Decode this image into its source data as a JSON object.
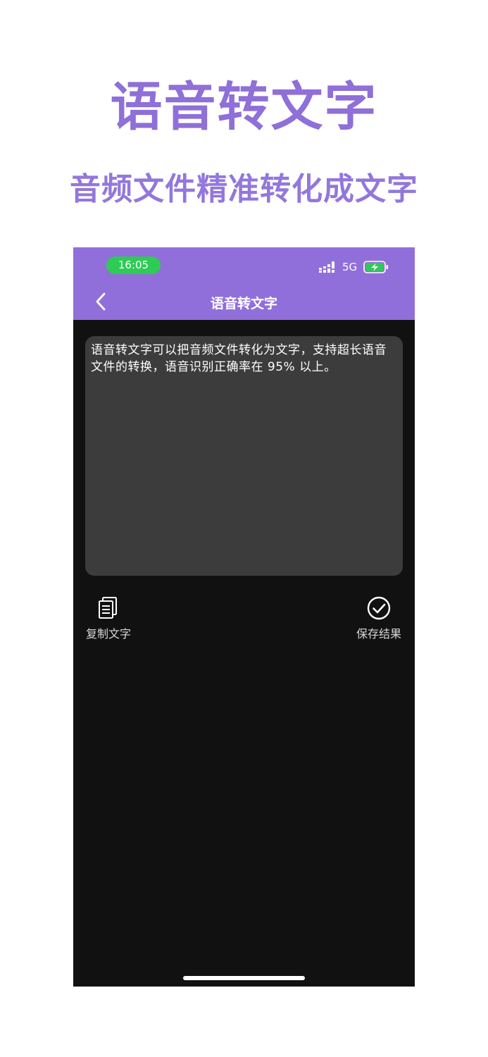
{
  "promo": {
    "title": "语音转文字",
    "subtitle": "音频文件精准转化成文字"
  },
  "status_bar": {
    "time": "16:05",
    "network": "5G"
  },
  "nav": {
    "title": "语音转文字"
  },
  "content": {
    "text": "语音转文字可以把音频文件转化为文字，支持超长语音文件的转换，语音识别正确率在 95% 以上。"
  },
  "actions": {
    "copy_label": "复制文字",
    "save_label": "保存结果"
  },
  "colors": {
    "accent": "#916fda",
    "promo_text": "#8f6fd8",
    "screen_background": "#111111",
    "text_box_background": "#3c3c3c",
    "time_pill": "#2ecb55",
    "battery_charge": "#2ecb55"
  },
  "icons": {
    "back": "chevron-left-icon",
    "signal": "signal-bars-icon",
    "battery": "battery-charging-icon",
    "copy": "document-copy-icon",
    "save": "check-circle-icon"
  }
}
